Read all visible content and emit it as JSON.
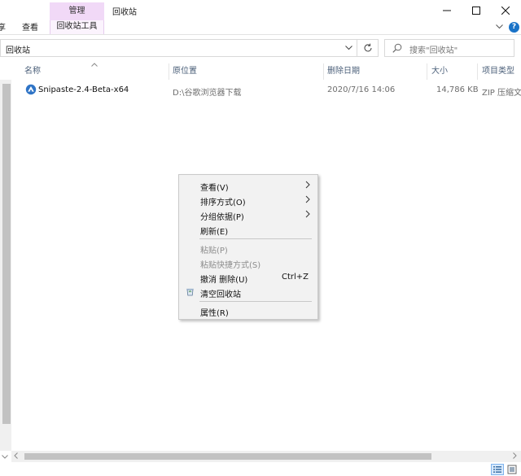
{
  "window": {
    "title": "回收站",
    "context_tab": "管理",
    "minimize_label": "",
    "maximize_label": "",
    "close_label": ""
  },
  "ribbon": {
    "tabs": [
      {
        "label": "享"
      },
      {
        "label": "查看"
      },
      {
        "label": "回收站工具"
      }
    ],
    "help_label": "?"
  },
  "address": {
    "path": "回收站",
    "search_placeholder": "搜索\"回收站\""
  },
  "columns": [
    {
      "label": "名称"
    },
    {
      "label": "原位置"
    },
    {
      "label": "删除日期"
    },
    {
      "label": "大小"
    },
    {
      "label": "项目类型"
    }
  ],
  "files": [
    {
      "name": "Snipaste-2.4-Beta-x64",
      "location": "D:\\谷歌浏览器下载",
      "deleted": "2020/7/16 14:06",
      "size": "14,786 KB",
      "type": "ZIP 压缩文件"
    }
  ],
  "context_menu": {
    "items": [
      {
        "label": "查看(V)",
        "submenu": true
      },
      {
        "label": "排序方式(O)",
        "submenu": true
      },
      {
        "label": "分组依据(P)",
        "submenu": true
      },
      {
        "label": "刷新(E)"
      },
      {
        "label": "粘贴(P)",
        "disabled": true
      },
      {
        "label": "粘贴快捷方式(S)",
        "disabled": true
      },
      {
        "label": "撤消 删除(U)",
        "shortcut": "Ctrl+Z"
      },
      {
        "label": "清空回收站",
        "icon": "recycle-bin-icon"
      },
      {
        "label": "属性(R)"
      }
    ]
  },
  "colors": {
    "context_tab_bg": "#f1d9f7",
    "header_text": "#4c607a",
    "menu_bg": "#f2f2f2",
    "disabled_text": "#8d8d8d"
  }
}
